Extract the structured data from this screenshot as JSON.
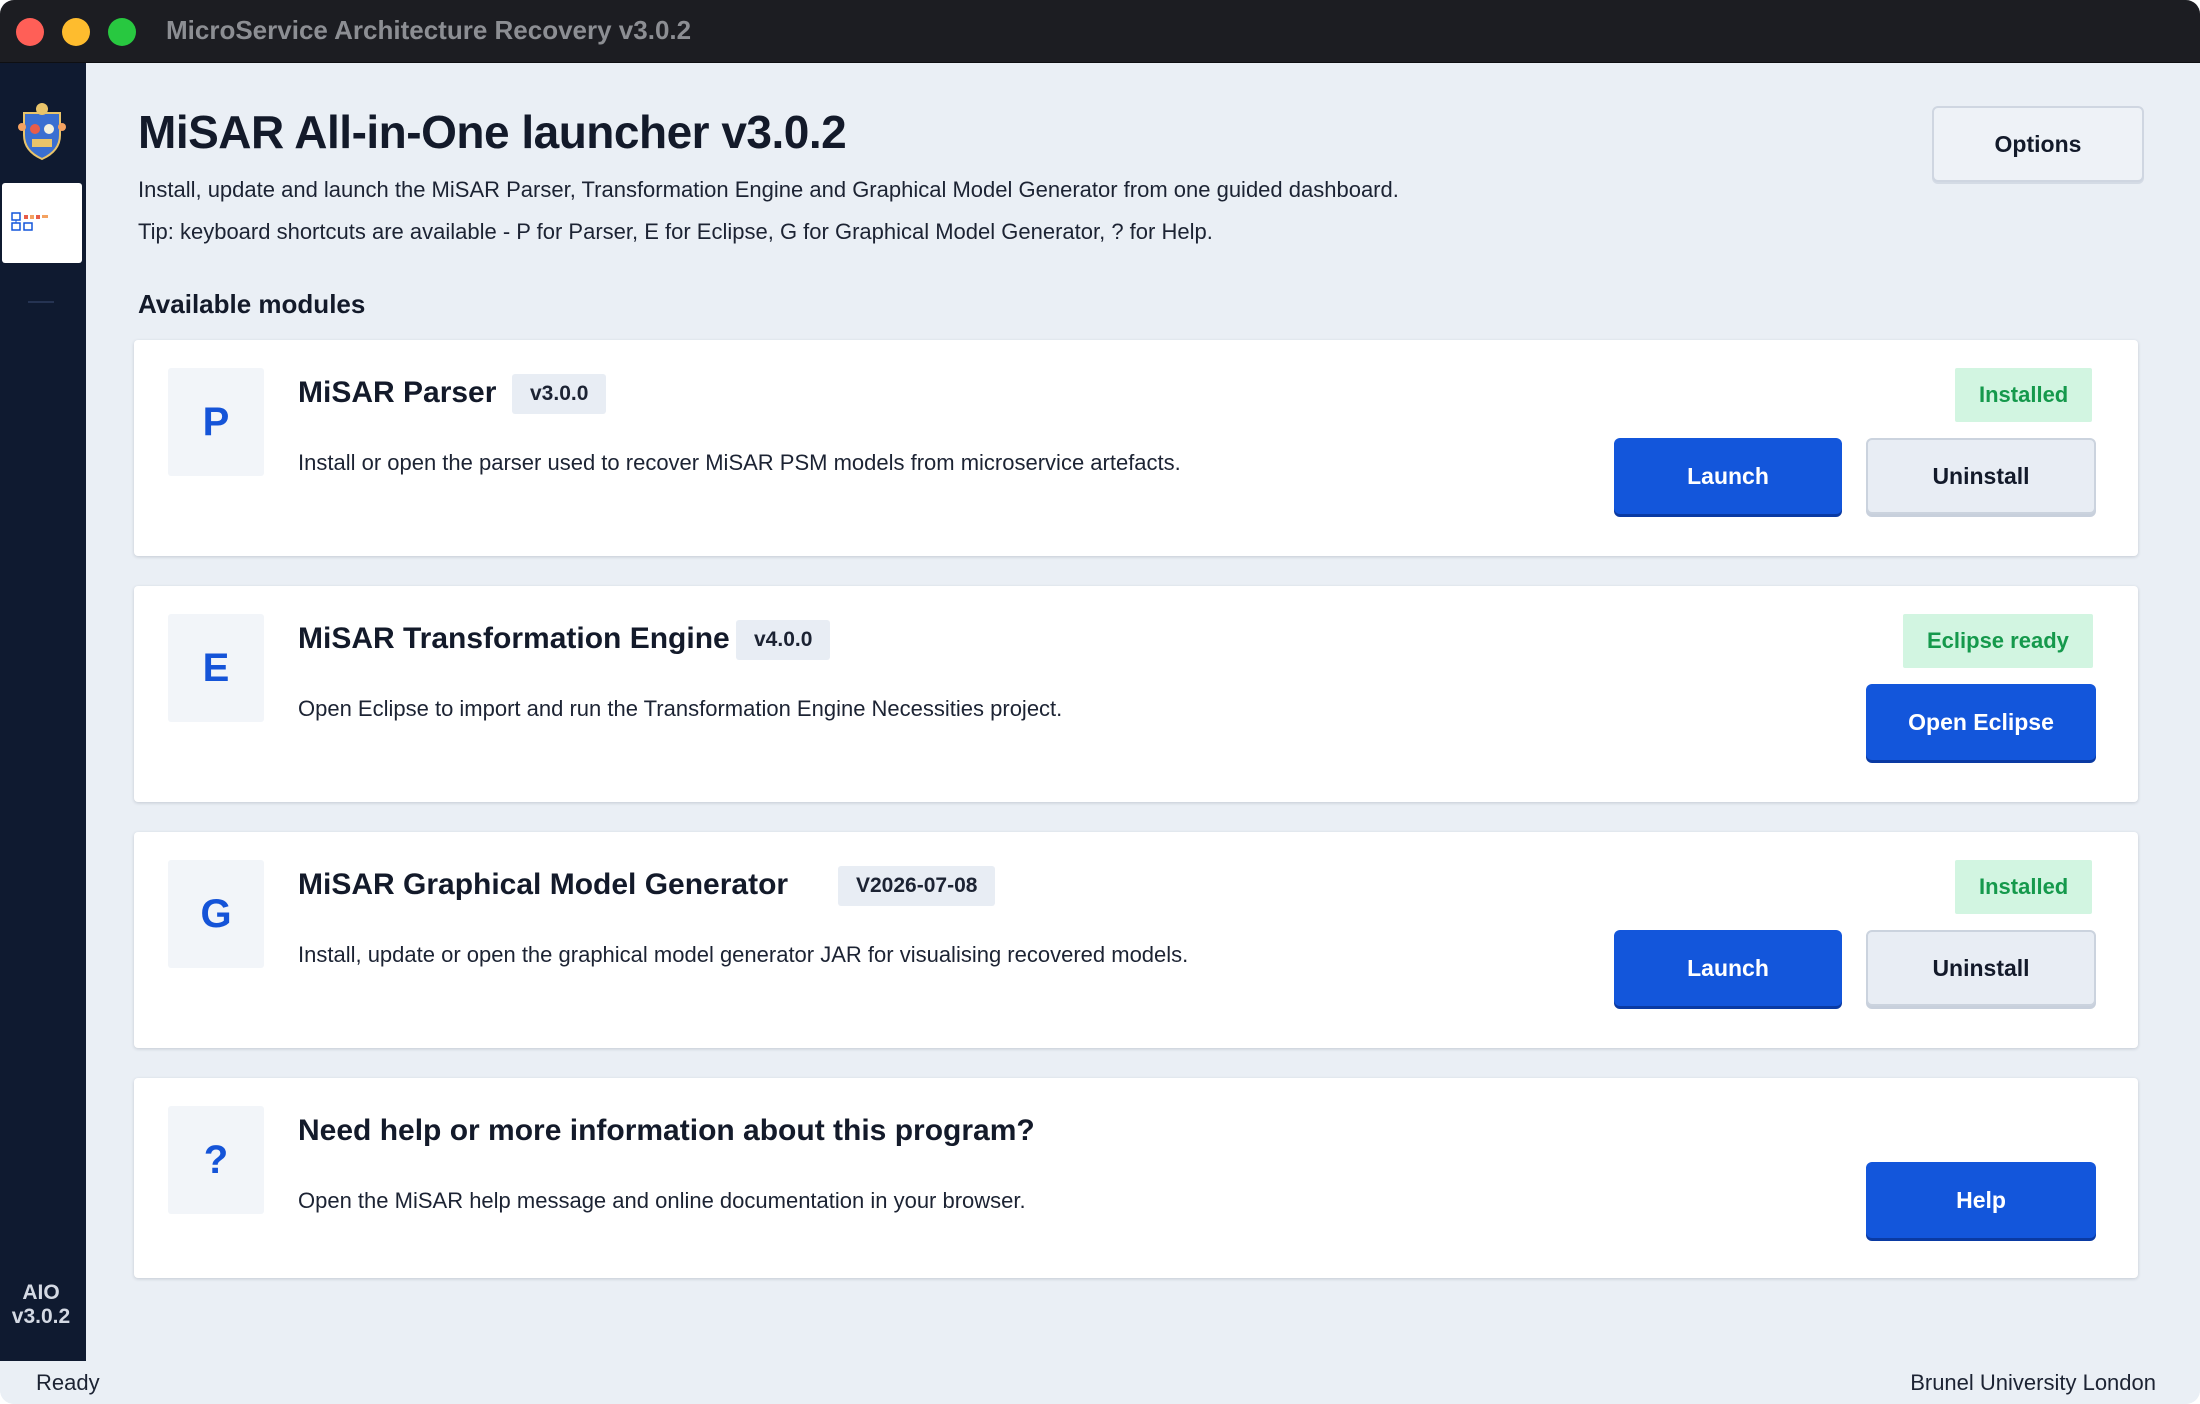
{
  "window": {
    "title": "MicroService Architecture Recovery v3.0.2"
  },
  "sidebar": {
    "version_line1": "AIO",
    "version_line2": "v3.0.2"
  },
  "header": {
    "title": "MiSAR All-in-One launcher v3.0.2",
    "subtitle": "Install, update and launch the MiSAR Parser, Transformation Engine and Graphical Model Generator from one guided dashboard.",
    "tip": "Tip: keyboard shortcuts are available - P for Parser, E for Eclipse, G for Graphical Model Generator, ? for Help.",
    "options_label": "Options"
  },
  "section_title": "Available modules",
  "modules": [
    {
      "icon_letter": "P",
      "name": "MiSAR Parser",
      "version": "v3.0.0",
      "description": "Install or open the parser used to recover MiSAR PSM models from microservice artefacts.",
      "status": "Installed",
      "primary_label": "Launch",
      "secondary_label": "Uninstall"
    },
    {
      "icon_letter": "E",
      "name": "MiSAR Transformation Engine",
      "version": "v4.0.0",
      "description": "Open Eclipse to import and run the Transformation Engine Necessities project.",
      "status": "Eclipse ready",
      "primary_label": "Open Eclipse"
    },
    {
      "icon_letter": "G",
      "name": "MiSAR Graphical Model Generator",
      "version": "V2026-07-08",
      "description": "Install, update or open the graphical model generator JAR for visualising recovered models.",
      "status": "Installed",
      "primary_label": "Launch",
      "secondary_label": "Uninstall"
    }
  ],
  "help_card": {
    "icon_letter": "?",
    "title": "Need help or more information about this program?",
    "description": "Open the MiSAR help message and online documentation in your browser.",
    "button_label": "Help"
  },
  "statusbar": {
    "left": "Ready",
    "right": "Brunel University London"
  },
  "colors": {
    "accent": "#1356db",
    "status_bg": "#d2f5e1",
    "status_text": "#15994c",
    "sidebar": "#0f1a30",
    "background": "#eaeff5"
  }
}
